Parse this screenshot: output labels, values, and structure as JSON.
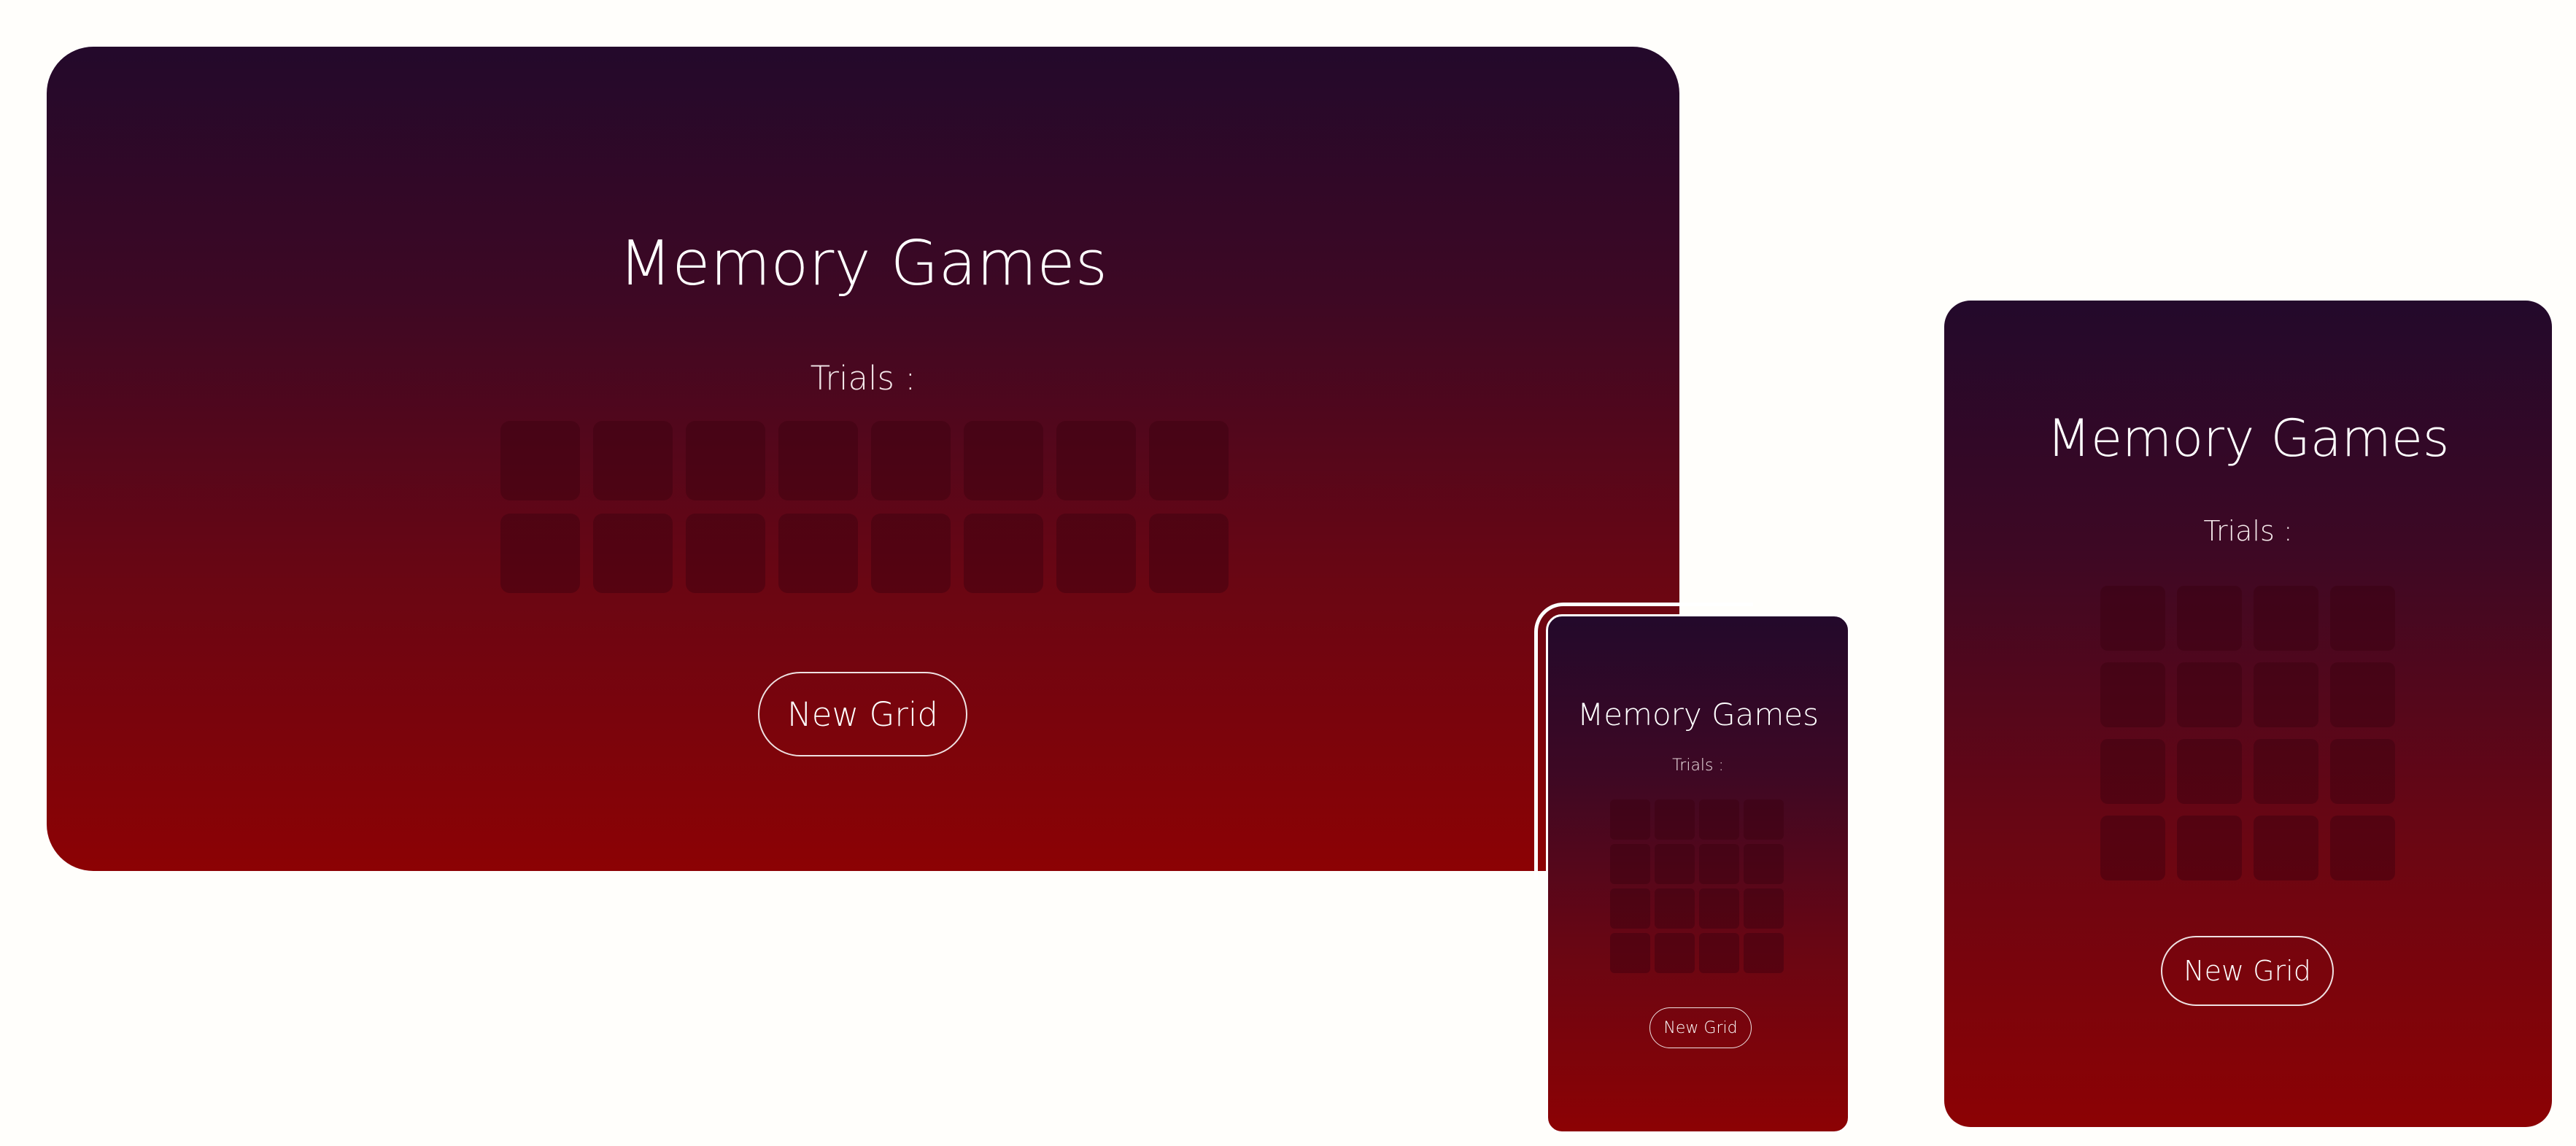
{
  "app": {
    "title": "Memory Games",
    "trials_label": "Trials :",
    "new_grid_label": "New Grid"
  },
  "theme": {
    "page_background": "#fffefb",
    "gradient_top": "#23092b",
    "gradient_bottom": "#8c0204",
    "text_color": "#ffffff"
  },
  "devices": [
    {
      "id": "desktop",
      "title": "Memory Games",
      "trials_label": "Trials :",
      "button_label": "New Grid",
      "grid": {
        "rows": 2,
        "columns": 8
      }
    },
    {
      "id": "phone",
      "title": "Memory Games",
      "trials_label": "Trials :",
      "button_label": "New Grid",
      "grid": {
        "rows": 4,
        "columns": 4
      }
    },
    {
      "id": "tablet",
      "title": "Memory Games",
      "trials_label": "Trials :",
      "button_label": "New Grid",
      "grid": {
        "rows": 4,
        "columns": 4
      }
    }
  ]
}
